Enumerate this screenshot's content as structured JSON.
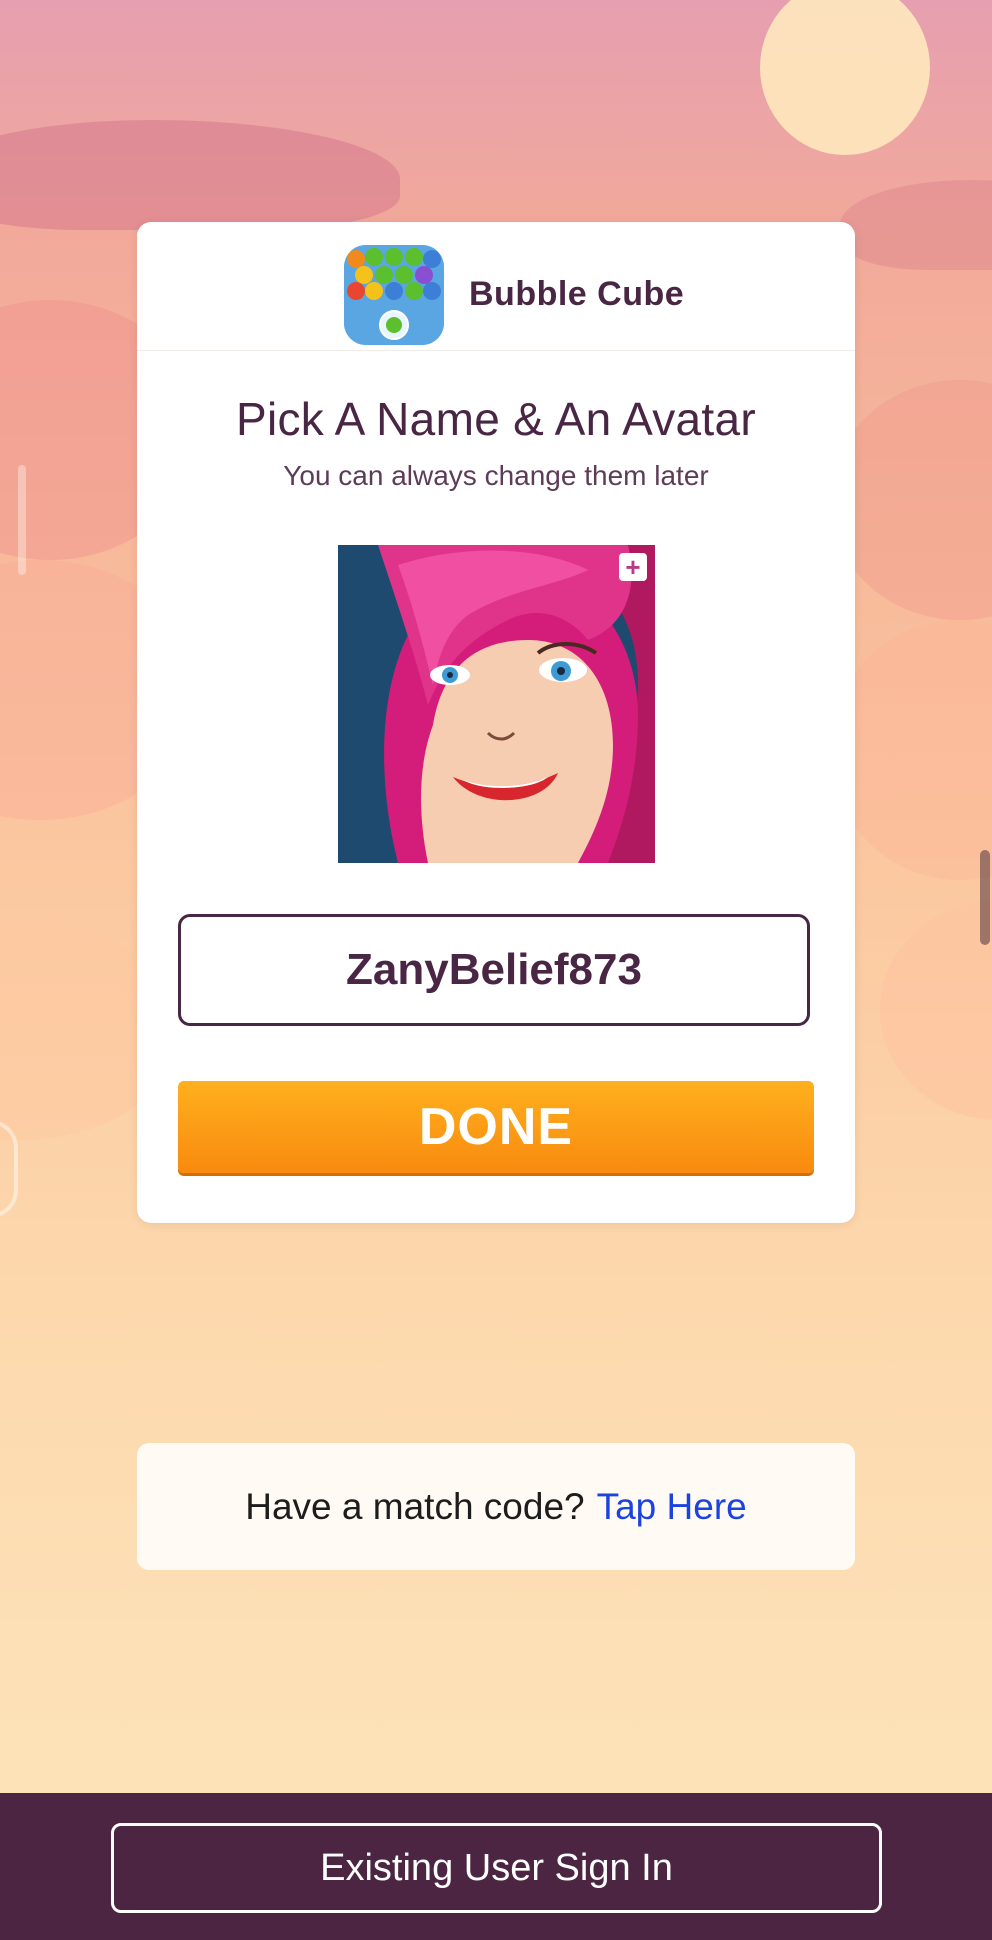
{
  "app": {
    "name": "Bubble Cube",
    "icon": "bubble-cube-app-icon"
  },
  "setup": {
    "title": "Pick A Name & An Avatar",
    "subtitle": "You can always change them later",
    "avatar_edit_symbol": "+",
    "username": "ZanyBelief873",
    "done_label": "DONE"
  },
  "match": {
    "prompt": "Have a match code?",
    "link": "Tap Here"
  },
  "footer": {
    "signin_label": "Existing User Sign In"
  },
  "colors": {
    "brand_purple": "#4a2645",
    "done_orange": "#f9950f",
    "link_blue": "#1a43e0",
    "footer_bg": "#4b2542"
  }
}
